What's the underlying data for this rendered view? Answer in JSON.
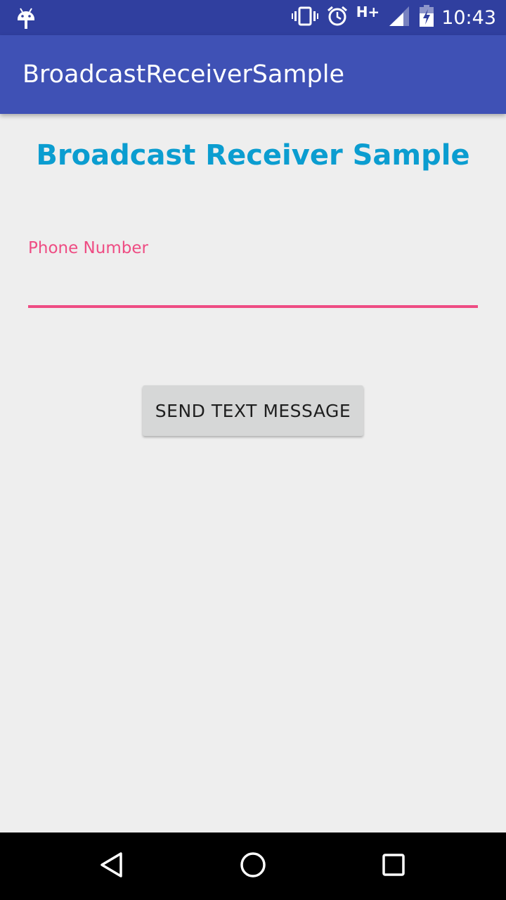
{
  "status_bar": {
    "network": "H+",
    "time": "10:43",
    "icons": [
      "android-debug-icon",
      "vibrate-icon",
      "alarm-icon",
      "signal-icon",
      "battery-charging-icon"
    ]
  },
  "app_bar": {
    "title": "BroadcastReceiverSample"
  },
  "main": {
    "heading": "Broadcast Receiver Sample",
    "phone_field": {
      "label": "Phone Number",
      "value": "",
      "placeholder": ""
    },
    "send_button_label": "SEND TEXT MESSAGE"
  },
  "nav_bar": {
    "items": [
      "back-icon",
      "home-icon",
      "recents-icon"
    ]
  },
  "colors": {
    "status_bar": "#303f9f",
    "app_bar": "#3f51b5",
    "heading": "#0b9dd0",
    "accent": "#ee4c83",
    "background": "#eeeeee",
    "button": "#d6d7d7"
  }
}
